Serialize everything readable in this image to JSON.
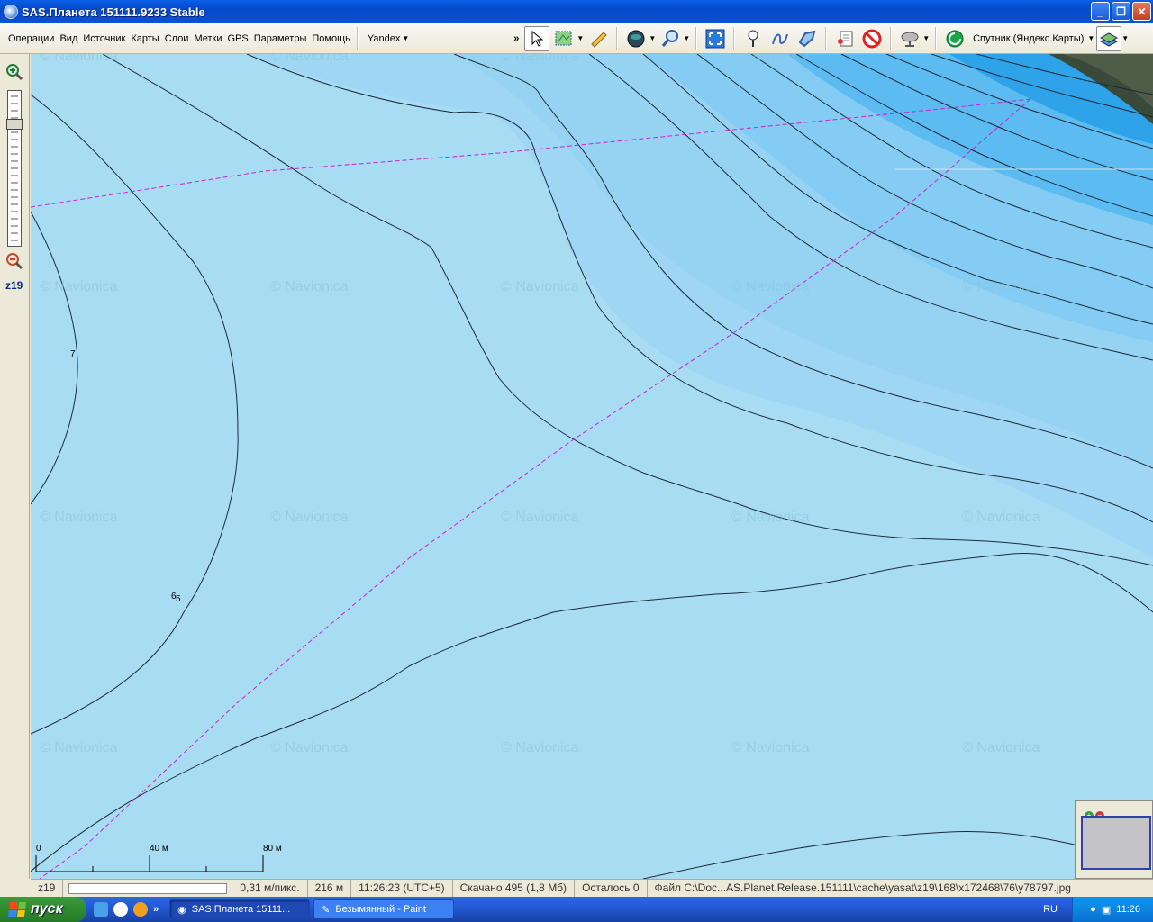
{
  "window": {
    "title": "SAS.Планета 151111.9233 Stable",
    "buttons": {
      "minimize": "_",
      "maximize": "❐",
      "close": "✕"
    }
  },
  "menu": {
    "items": [
      "Операции",
      "Вид",
      "Источник",
      "Карты",
      "Слои",
      "Метки",
      "GPS",
      "Параметры",
      "Помощь"
    ]
  },
  "toolbar": {
    "source": "Yandex",
    "overflow": "»",
    "map_name": "Спутник (Яндекс.Карты)"
  },
  "zoom": {
    "level": "z19"
  },
  "map": {
    "watermark": "© Navionica",
    "depth_labels": [
      "7",
      "6",
      "5"
    ],
    "scale": {
      "ticks": [
        "0",
        "40 м",
        "80 м"
      ]
    }
  },
  "status": {
    "zoom": "z19",
    "resolution": "0,31 м/пикс.",
    "distance": "216 м",
    "time": "11:26:23 (UTC+5)",
    "downloaded": "Скачано 495 (1,8 Мб)",
    "remaining": "Осталось 0",
    "file": "Файл C:\\Doc...AS.Planet.Release.151111\\cache\\yasat\\z19\\168\\x172468\\76\\y78797.jpg"
  },
  "taskbar": {
    "start": "пуск",
    "overflow": "»",
    "tasks": [
      {
        "label": "SAS.Планета 15111...",
        "active": true
      },
      {
        "label": "Безымянный - Paint",
        "active": false
      }
    ],
    "lang": "RU",
    "clock": "11:26"
  }
}
